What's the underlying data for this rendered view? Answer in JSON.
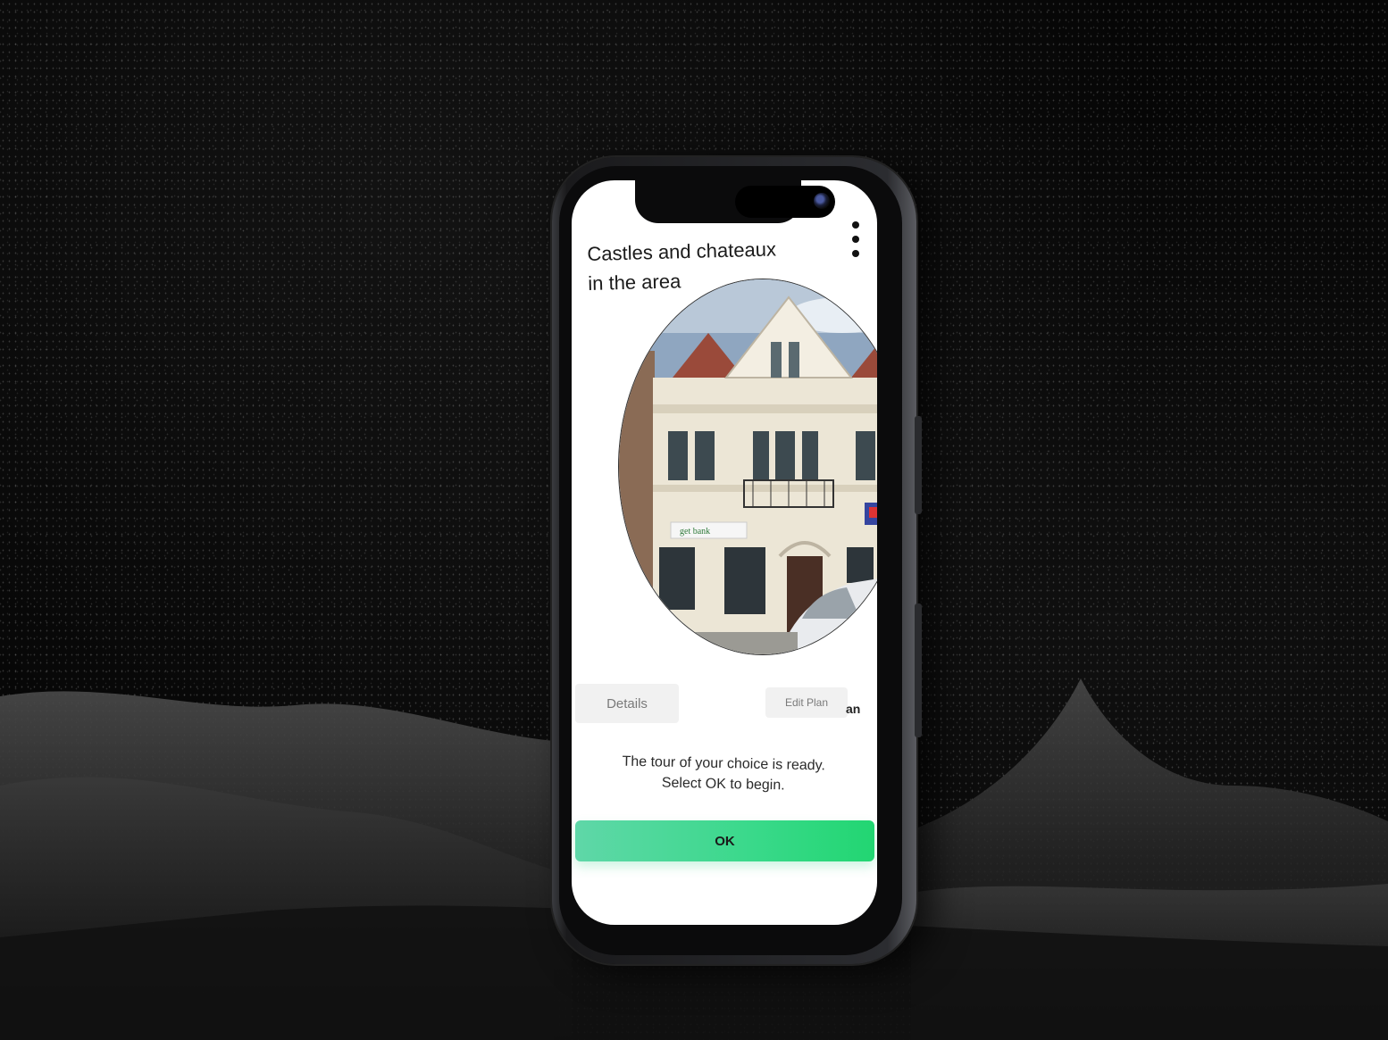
{
  "screen": {
    "title_line1": "Castles and chateaux",
    "title_line2": "in the area",
    "details_label": "Details",
    "edit_plan_label": "Edit Plan",
    "edit_plan_partial": "an",
    "message_line1": "The tour of your choice is ready.",
    "message_line2": "Select OK to begin.",
    "ok_label": "OK",
    "photo_sign_text": "get bank"
  },
  "colors": {
    "ok_gradient_start": "#5fd7a8",
    "ok_gradient_end": "#22d672",
    "background": "#060606",
    "screen": "#ffffff"
  },
  "icons": {
    "menu": "more-vertical-icon",
    "camera": "camera-icon"
  }
}
